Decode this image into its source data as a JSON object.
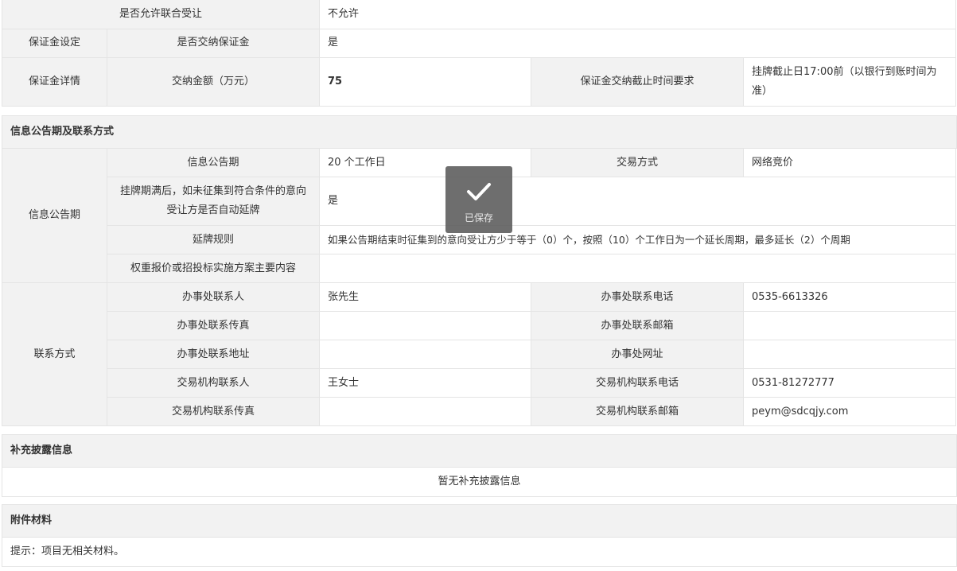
{
  "section1": {
    "joint_label": "是否允许联合受让",
    "joint_value": "不允许",
    "deposit_setting_label": "保证金设定",
    "deposit_required_label": "是否交纳保证金",
    "deposit_required_value": "是",
    "deposit_detail_label": "保证金详情",
    "deposit_amount_label": "交纳金额（万元）",
    "deposit_amount_value": "75",
    "deposit_deadline_label": "保证金交纳截止时间要求",
    "deposit_deadline_value": "挂牌截止日17:00前（以银行到账时间为准）"
  },
  "section2": {
    "header": "信息公告期及联系方式",
    "period_group_label": "信息公告期",
    "period_label": "信息公告期",
    "period_value": "20 个工作日",
    "trade_method_label": "交易方式",
    "trade_method_value": "网络竞价",
    "auto_extend_label": "挂牌期满后，如未征集到符合条件的意向受让方是否自动延牌",
    "auto_extend_value": "是",
    "extend_rule_label": "延牌规则",
    "extend_rule_value": "如果公告期结束时征集到的意向受让方少于等于（0）个，按照（10）个工作日为一个延长周期，最多延长（2）个周期",
    "weighted_label": "权重报价或招投标实施方案主要内容",
    "weighted_value": "",
    "contact_group_label": "联系方式",
    "office_contact_label": "办事处联系人",
    "office_contact_value": "张先生",
    "office_phone_label": "办事处联系电话",
    "office_phone_value": "0535-6613326",
    "office_fax_label": "办事处联系传真",
    "office_fax_value": "",
    "office_email_label": "办事处联系邮箱",
    "office_email_value": "",
    "office_address_label": "办事处联系地址",
    "office_address_value": "",
    "office_website_label": "办事处网址",
    "office_website_value": "",
    "agency_contact_label": "交易机构联系人",
    "agency_contact_value": "王女士",
    "agency_phone_label": "交易机构联系电话",
    "agency_phone_value": "0531-81272777",
    "agency_fax_label": "交易机构联系传真",
    "agency_fax_value": "",
    "agency_email_label": "交易机构联系邮箱",
    "agency_email_value": "peym@sdcqjy.com"
  },
  "section3": {
    "header": "补充披露信息",
    "body": "暂无补充披露信息"
  },
  "section4": {
    "header": "附件材料",
    "body": "提示：项目无相关材料。"
  },
  "toast": {
    "icon": "check-icon",
    "text": "已保存"
  }
}
